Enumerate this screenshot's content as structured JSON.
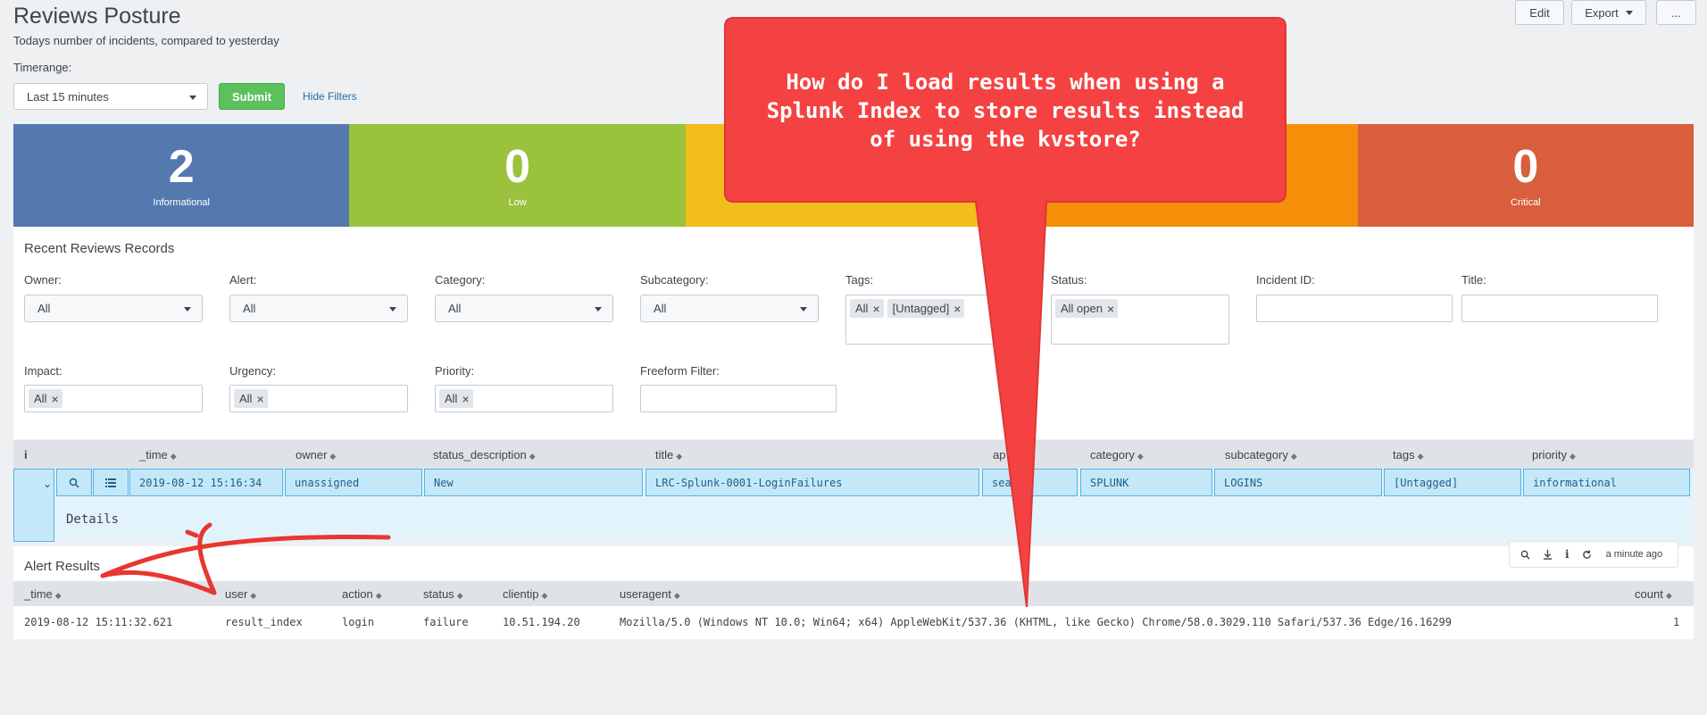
{
  "page": {
    "title": "Reviews Posture",
    "subtitle": "Todays number of incidents, compared to yesterday"
  },
  "toolbar": {
    "edit": "Edit",
    "export": "Export",
    "more": "..."
  },
  "timerange": {
    "label": "Timerange:",
    "value": "Last 15 minutes",
    "submit": "Submit",
    "hide_filters": "Hide Filters"
  },
  "kpis": [
    {
      "value": "2",
      "label": "Informational",
      "color": "#5379af"
    },
    {
      "value": "0",
      "label": "Low",
      "color": "#9ac23c"
    },
    {
      "value": "",
      "label": "",
      "color": "#f1be1e"
    },
    {
      "value": "",
      "label": "",
      "color": "#f58f0a"
    },
    {
      "value": "0",
      "label": "Critical",
      "color": "#d85e3d"
    }
  ],
  "reviews": {
    "title": "Recent Reviews Records",
    "filters": {
      "owner": {
        "label": "Owner:",
        "value": "All"
      },
      "alert": {
        "label": "Alert:",
        "value": "All"
      },
      "category": {
        "label": "Category:",
        "value": "All"
      },
      "subcategory": {
        "label": "Subcategory:",
        "value": "All"
      },
      "tags": {
        "label": "Tags:",
        "tokens": [
          "All",
          "[Untagged]"
        ]
      },
      "status": {
        "label": "Status:",
        "tokens": [
          "All open"
        ]
      },
      "incident_id": {
        "label": "Incident ID:"
      },
      "title": {
        "label": "Title:"
      },
      "impact": {
        "label": "Impact:",
        "tokens": [
          "All"
        ]
      },
      "urgency": {
        "label": "Urgency:",
        "tokens": [
          "All"
        ]
      },
      "priority": {
        "label": "Priority:",
        "tokens": [
          "All"
        ]
      },
      "freeform": {
        "label": "Freeform Filter:"
      }
    },
    "columns": [
      "i",
      "_time",
      "owner",
      "status_description",
      "title",
      "ap",
      "category",
      "subcategory",
      "tags",
      "priority"
    ],
    "row": {
      "time": "2019-08-12 15:16:34",
      "owner": "unassigned",
      "status_description": "New",
      "title": "LRC-Splunk-0001-LoginFailures",
      "alert": "sea",
      "category": "SPLUNK",
      "subcategory": "LOGINS",
      "tags": "[Untagged]",
      "priority": "informational"
    },
    "details": "Details"
  },
  "alert_results": {
    "title": "Alert Results",
    "updated": "a minute ago",
    "columns": [
      "_time",
      "user",
      "action",
      "status",
      "clientip",
      "useragent",
      "count"
    ],
    "rows": [
      {
        "time": "2019-08-12 15:11:32.621",
        "user": "result_index",
        "action": "login",
        "status": "failure",
        "clientip": "10.51.194.20",
        "useragent": "Mozilla/5.0 (Windows NT 10.0; Win64; x64) AppleWebKit/537.36 (KHTML, like Gecko) Chrome/58.0.3029.110 Safari/537.36 Edge/16.16299",
        "count": "1"
      }
    ]
  },
  "annotation": {
    "callout_lines": [
      "How do I load results when using a",
      "Splunk Index to store results instead",
      "of using the kvstore?"
    ],
    "callout_color": "#f44242",
    "arrow_color": "#e8372f"
  },
  "icons": [
    "search-icon",
    "list-icon",
    "download-icon",
    "info-icon",
    "refresh-icon",
    "chevron-down-icon"
  ]
}
